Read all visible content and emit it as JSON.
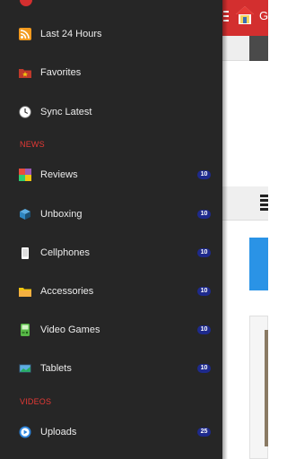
{
  "app": {
    "title": "Ge",
    "colors": {
      "header": "#d32f2f",
      "drawer": "#262626",
      "badge": "#1e2a8c",
      "section": "#e53935",
      "accent_blue": "#2a93e6"
    }
  },
  "drawer": {
    "items_top": [
      {
        "label": "Last 24 Hours",
        "icon": "rss-icon"
      },
      {
        "label": "Favorites",
        "icon": "favorites-folder-icon"
      },
      {
        "label": "Sync Latest",
        "icon": "clock-icon"
      }
    ],
    "news_header": "NEWS",
    "news_items": [
      {
        "label": "Reviews",
        "icon": "reviews-icon",
        "badge": "10"
      },
      {
        "label": "Unboxing",
        "icon": "box-icon",
        "badge": "10"
      },
      {
        "label": "Cellphones",
        "icon": "phone-icon",
        "badge": "10"
      },
      {
        "label": "Accessories",
        "icon": "folder-icon",
        "badge": "10"
      },
      {
        "label": "Video Games",
        "icon": "gameboy-icon",
        "badge": "10"
      },
      {
        "label": "Tablets",
        "icon": "tablet-icon",
        "badge": "10"
      }
    ],
    "videos_header": "VIDEOS",
    "video_items": [
      {
        "label": "Uploads",
        "icon": "play-icon",
        "badge": "25"
      }
    ]
  }
}
